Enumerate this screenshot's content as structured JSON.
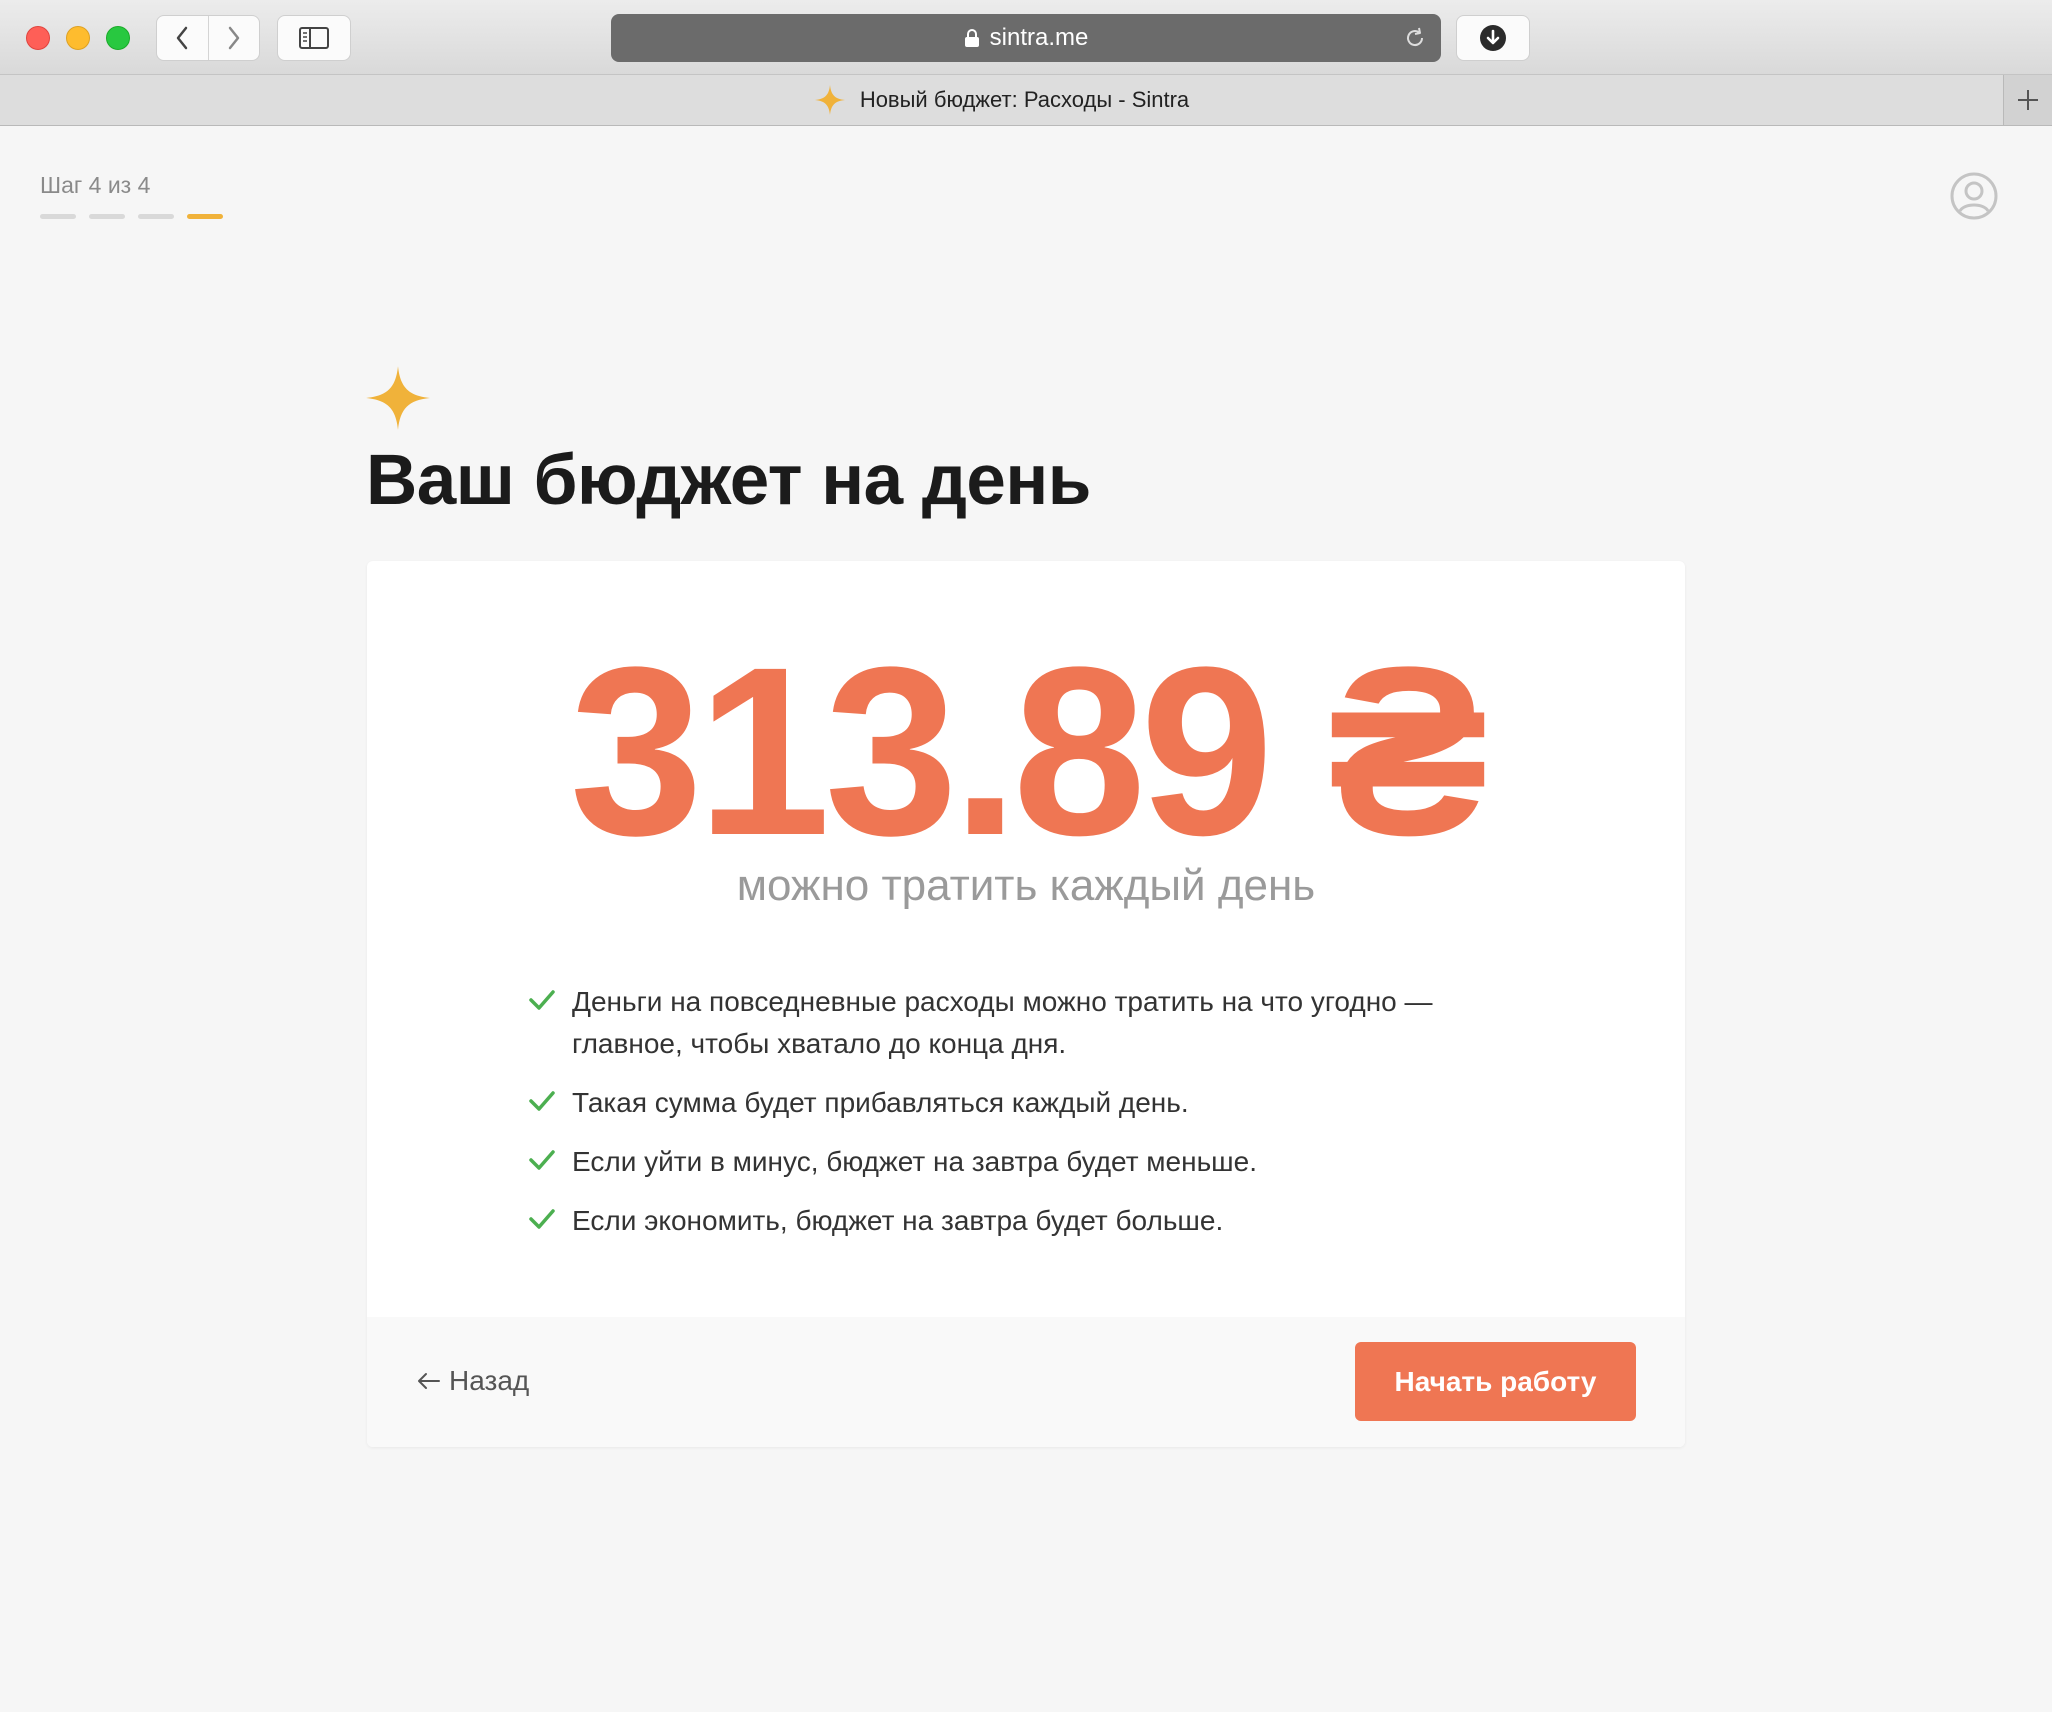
{
  "browser": {
    "url": "sintra.me",
    "tab_title": "Новый бюджет: Расходы - Sintra",
    "icons": {
      "back": "chevron-left-icon",
      "forward": "chevron-right-icon",
      "sidebar": "sidebar-icon",
      "lock": "lock-icon",
      "reload": "reload-icon",
      "download": "download-icon",
      "new_tab": "plus-icon"
    }
  },
  "progress": {
    "label": "Шаг 4 из 4",
    "current_step": 4,
    "total_steps": 4
  },
  "header": {
    "title": "Ваш бюджет на день"
  },
  "budget": {
    "amount": "313.89 ₴",
    "subtitle": "можно тратить каждый день"
  },
  "bullets": [
    "Деньги на повседневные расходы можно тратить на что угодно — главное, чтобы хватало до конца дня.",
    "Такая сумма будет прибавляться каждый день.",
    "Если уйти в минус, бюджет на завтра будет меньше.",
    "Если экономить, бюджет на завтра будет больше."
  ],
  "footer": {
    "back_label": "Назад",
    "start_label": "Начать работу"
  },
  "colors": {
    "accent": "#ef7653",
    "sparkle": "#f0b23a",
    "check": "#4caf50",
    "progress_active": "#f0b23a",
    "progress_inactive": "#d9d9d9"
  }
}
